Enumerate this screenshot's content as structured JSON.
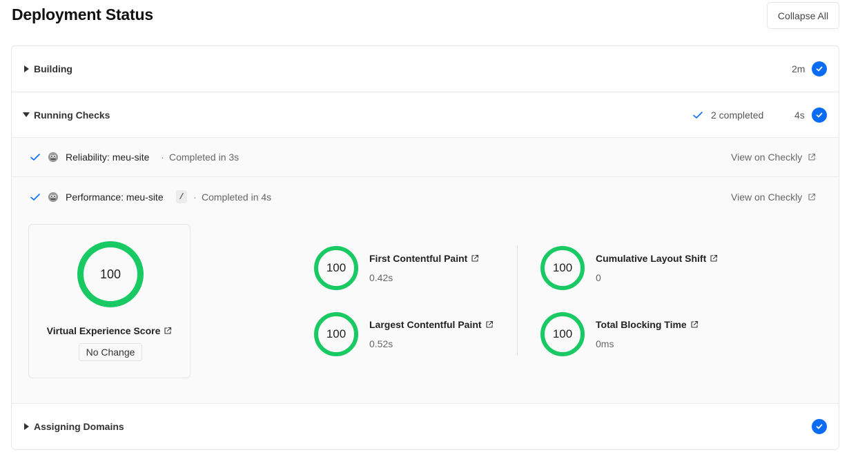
{
  "header": {
    "title": "Deployment Status",
    "collapse_label": "Collapse All"
  },
  "sections": {
    "building": {
      "label": "Building",
      "duration": "2m"
    },
    "running_checks": {
      "label": "Running Checks",
      "completed": "2 completed",
      "duration": "4s"
    },
    "assigning_domains": {
      "label": "Assigning Domains"
    }
  },
  "checks": [
    {
      "name": "Reliability: meu-site",
      "separator": "·",
      "time": "Completed in 3s",
      "link": "View on Checkly"
    },
    {
      "name": "Performance: meu-site",
      "path": "/",
      "separator": "·",
      "time": "Completed in 4s",
      "link": "View on Checkly"
    }
  ],
  "score": {
    "value": "100",
    "label": "Virtual Experience Score",
    "change": "No Change"
  },
  "metrics": [
    {
      "score": "100",
      "title": "First Contentful Paint",
      "value": "0.42s"
    },
    {
      "score": "100",
      "title": "Largest Contentful Paint",
      "value": "0.52s"
    },
    {
      "score": "100",
      "title": "Cumulative Layout Shift",
      "value": "0"
    },
    {
      "score": "100",
      "title": "Total Blocking Time",
      "value": "0ms"
    }
  ],
  "colors": {
    "accent_blue": "#0a6cf5",
    "score_green": "#18c964"
  },
  "icons": {
    "expand": "caret-right-icon",
    "collapse": "caret-down-icon",
    "done": "check-circle-icon",
    "external": "external-link-icon",
    "checkly": "checkly-logo-icon"
  }
}
